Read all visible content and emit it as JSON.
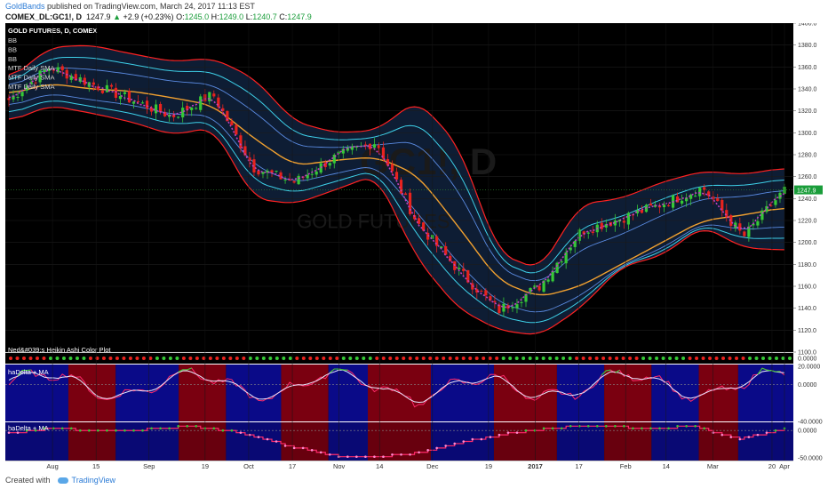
{
  "header": {
    "author": "GoldBands",
    "published": "published on TradingView.com, March 24, 2017 11:13 EST",
    "symbol": "COMEX_DL:GC1!, D",
    "last": "1247.9",
    "change_arrow": "▲",
    "change": "+2.9 (+0.23%)",
    "o_label": "O:",
    "o": "1245.0",
    "h_label": "H:",
    "h": "1249.0",
    "l_label": "L:",
    "l": "1240.7",
    "c_label": "C:",
    "c": "1247.9"
  },
  "footer": {
    "created": "Created with",
    "brand": "TradingView"
  },
  "watermark": {
    "ticker": "GC1!, D",
    "name": "GOLD FUTURES"
  },
  "colors": {
    "bg": "#000000",
    "up": "#36c936",
    "down": "#e8231e",
    "bandOuter": "#ff2222",
    "bandMid": "#3ed0e8",
    "sma": "#f0a030",
    "ha": "#c040c0",
    "blue": "#0a0a88",
    "red": "#7a0010"
  },
  "chart_data": [
    {
      "type": "candlestick",
      "title": "GOLD FUTURES, D, COMEX",
      "legend": [
        "BB",
        "BB",
        "BB",
        "MTF Daily SMA",
        "MTF Daily SMA",
        "MTF Daily SMA"
      ],
      "ylim": [
        1100,
        1400
      ],
      "yticks": [
        1100,
        1120,
        1140,
        1160,
        1180,
        1200,
        1220,
        1240,
        1260,
        1280,
        1300,
        1320,
        1340,
        1360,
        1380,
        1400
      ],
      "last_price_label": "1247.9",
      "xticks": [
        "Aug",
        "15",
        "Sep",
        "19",
        "Oct",
        "17",
        "Nov",
        "14",
        "Dec",
        "19",
        "2017",
        "17",
        "Feb",
        "14",
        "Mar",
        "20",
        "Apr"
      ],
      "xtick_bold": [
        "2017"
      ],
      "x_anchor_dates": [
        "2016-07-18",
        "2016-08-01",
        "2016-08-15",
        "2016-09-01",
        "2016-09-19",
        "2016-10-03",
        "2016-10-17",
        "2016-11-01",
        "2016-11-14",
        "2016-12-01",
        "2016-12-19",
        "2017-01-03",
        "2017-01-17",
        "2017-02-01",
        "2017-02-14",
        "2017-03-01",
        "2017-03-20",
        "2017-03-24"
      ],
      "close_anchors": [
        1330,
        1360,
        1345,
        1330,
        1315,
        1335,
        1268,
        1255,
        1278,
        1292,
        1218,
        1175,
        1138,
        1160,
        1210,
        1222,
        1235,
        1250,
        1205,
        1247.9
      ],
      "sma_anchors": [
        1335,
        1345,
        1340,
        1338,
        1332,
        1325,
        1295,
        1270,
        1275,
        1278,
        1262,
        1215,
        1165,
        1150,
        1160,
        1180,
        1200,
        1220,
        1225,
        1232
      ],
      "upper_band_anchors": [
        1348,
        1378,
        1380,
        1372,
        1365,
        1368,
        1350,
        1310,
        1300,
        1302,
        1330,
        1290,
        1190,
        1175,
        1235,
        1240,
        1255,
        1265,
        1262,
        1268
      ],
      "lower_band_anchors": [
        1310,
        1325,
        1318,
        1310,
        1298,
        1305,
        1240,
        1235,
        1248,
        1262,
        1185,
        1140,
        1120,
        1115,
        1140,
        1178,
        1188,
        1215,
        1195,
        1193
      ]
    },
    {
      "type": "heatmap",
      "title": "Ned&#039;s Heikin Ashi Color Plot",
      "yticks": [
        "0.0000"
      ],
      "series": [
        {
          "name": "Ned&#039;s Heikin Ashi Color Plot",
          "colors": [
            "red",
            "green"
          ]
        }
      ]
    },
    {
      "type": "line",
      "title": "haDelta + MA",
      "ylim": [
        -40,
        22
      ],
      "yticks": [
        "20.0000",
        "0.0000",
        "-40.0000"
      ],
      "regimes": [
        "blue",
        "red",
        "blue",
        "red",
        "blue",
        "red",
        "blue",
        "red",
        "blue",
        "red",
        "blue",
        "red",
        "blue",
        "red",
        "blue"
      ],
      "regime_bounds": [
        0,
        0.08,
        0.14,
        0.22,
        0.28,
        0.35,
        0.41,
        0.46,
        0.54,
        0.62,
        0.7,
        0.76,
        0.82,
        0.88,
        0.93,
        1.0
      ]
    },
    {
      "type": "line",
      "title": "haDelta + MA",
      "ylim": [
        -55,
        15
      ],
      "yticks": [
        "0.0000",
        "-50.0000"
      ],
      "step_anchors": [
        -5,
        5,
        -2,
        2,
        8,
        -3,
        -25,
        -45,
        -50,
        -40,
        -20,
        -5,
        5,
        10,
        3,
        8,
        -15,
        2
      ]
    }
  ]
}
